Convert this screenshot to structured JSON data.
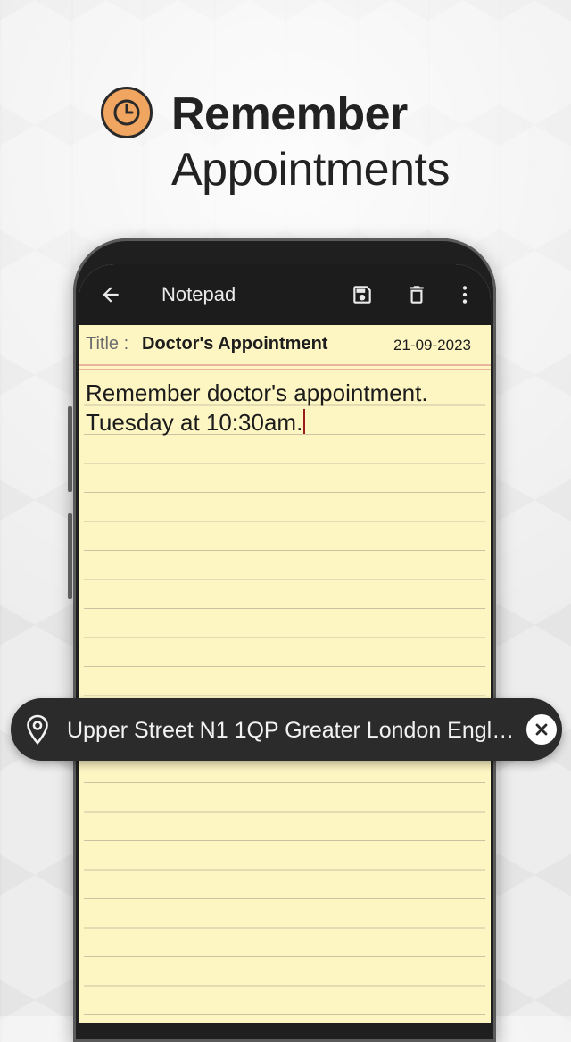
{
  "hero": {
    "title": "Remember",
    "subtitle": "Appointments",
    "icon": "clock-icon",
    "accent_color": "#f0a560"
  },
  "appbar": {
    "title": "Notepad",
    "icons": [
      "back-arrow-icon",
      "save-icon",
      "delete-icon",
      "more-vert-icon"
    ]
  },
  "note": {
    "title_label": "Title :",
    "title": "Doctor's Appointment",
    "date": "21-09-2023",
    "body": "Remember doctor's appointment.\nTuesday at 10:30am.",
    "paper_color": "#fdf6c3"
  },
  "location": {
    "icon": "location-pin-icon",
    "text": "Upper Street N1 1QP Greater London Engla...",
    "close_icon": "close-icon"
  }
}
